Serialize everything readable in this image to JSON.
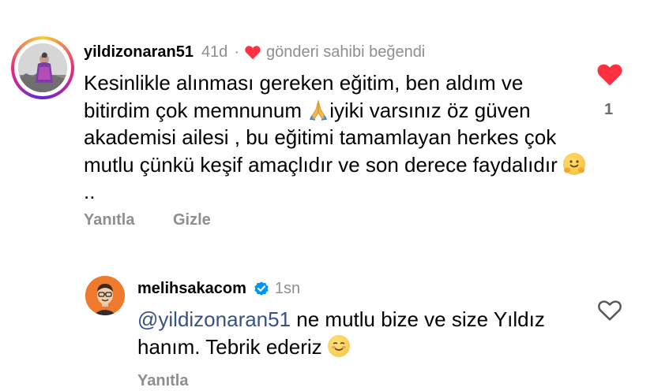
{
  "comment": {
    "username": "yildizonaran51",
    "time": "41d",
    "separator": "·",
    "author_liked": "gönderi sahibi beğendi",
    "text_part1": "Kesinlikle alınması gereken eğitim, ben aldım ve bitirdim çok memnunum ",
    "text_part2": "iyiki varsınız öz güven akademisi ailesi , bu eğitimi tamamlayan herkes çok mutlu çünkü keşif amaçlıdır ve son derece faydalıdır ",
    "text_part3": "..",
    "reply_label": "Yanıtla",
    "hide_label": "Gizle",
    "like_count": "1",
    "like_color": "#ff3040"
  },
  "reply": {
    "username": "melihsakacom",
    "time": "1sn",
    "mention": "@yildizonaran51",
    "text": " ne mutlu bize ve size Yıldız hanım. Tebrik ederiz ",
    "reply_label": "Yanıtla",
    "verified_color": "#0095f6",
    "mention_color": "#385185"
  },
  "icons": {
    "avatar": "user-photo",
    "heart_filled": "heart-filled-icon",
    "heart_outline": "heart-outline-icon",
    "verified": "verified-badge-icon",
    "emoji_pray": "folded-hands-emoji",
    "emoji_hug": "hugging-face-emoji",
    "emoji_blush": "smiling-blush-emoji"
  }
}
